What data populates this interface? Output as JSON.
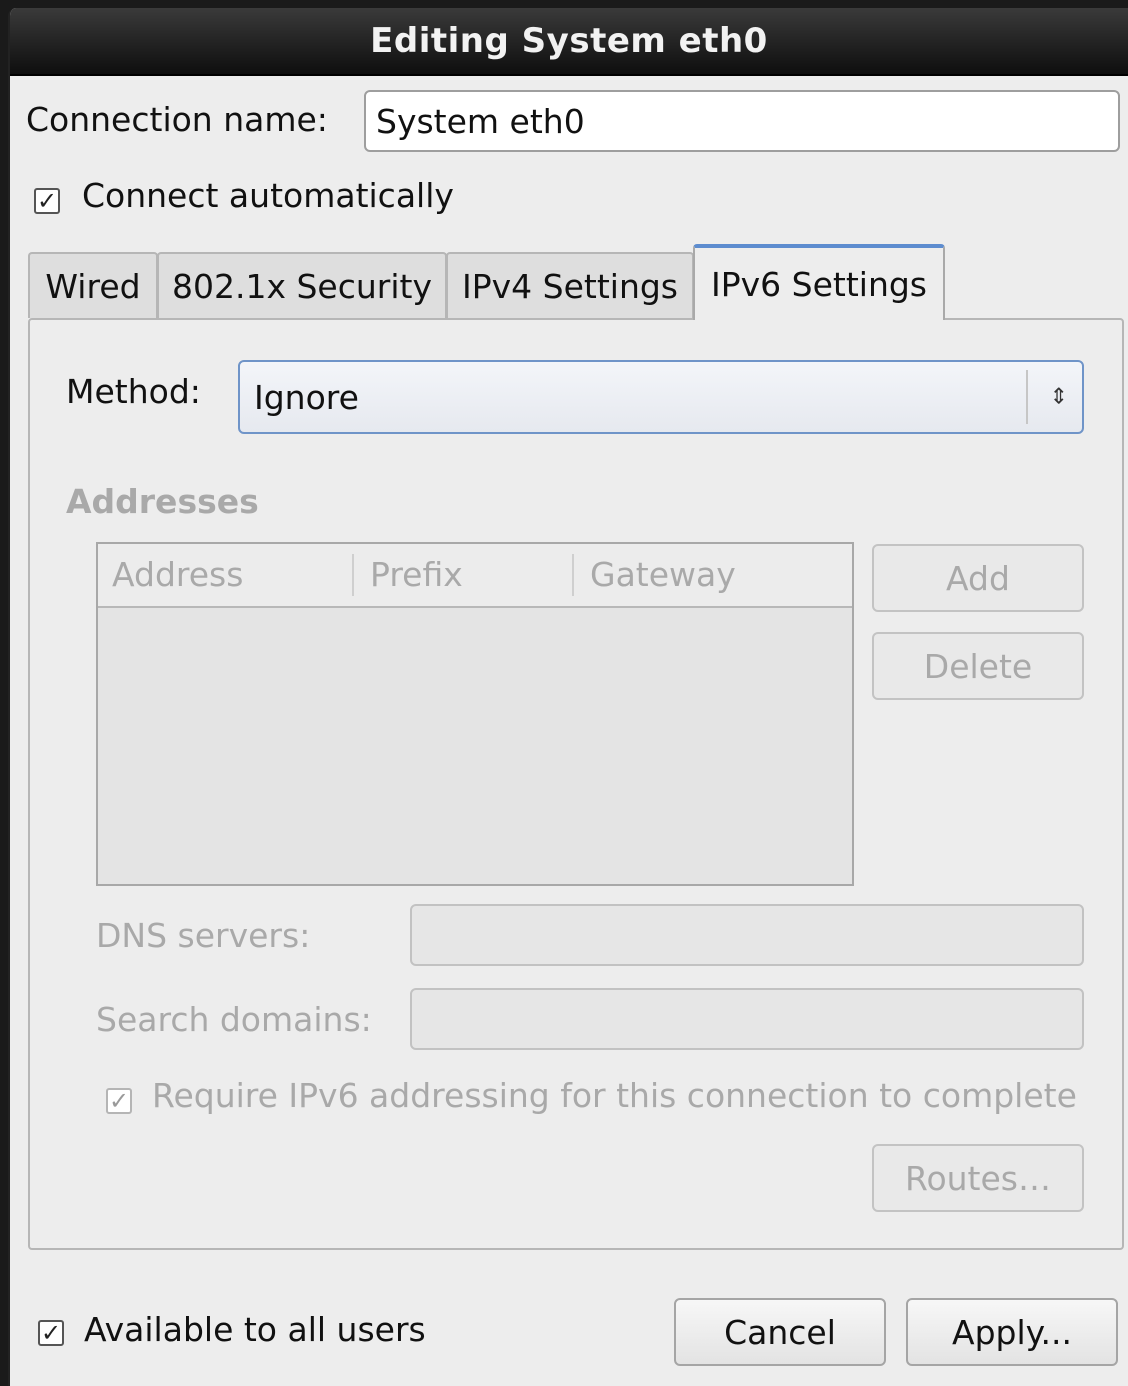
{
  "window": {
    "title": "Editing System eth0"
  },
  "connection": {
    "name_label": "Connection name:",
    "name_value": "System eth0"
  },
  "auto_connect": {
    "label": "Connect automatically",
    "checked": true,
    "mark": "✓"
  },
  "tabs": [
    {
      "label": "Wired",
      "active": false
    },
    {
      "label": "802.1x Security",
      "active": false
    },
    {
      "label": "IPv4 Settings",
      "active": false
    },
    {
      "label": "IPv6 Settings",
      "active": true
    }
  ],
  "ipv6": {
    "method_label": "Method:",
    "method_value": "Ignore",
    "combo_arrow": "⇕",
    "addresses_heading": "Addresses",
    "columns": [
      "Address",
      "Prefix",
      "Gateway"
    ],
    "rows": [],
    "add_label": "Add",
    "delete_label": "Delete",
    "dns_label": "DNS servers:",
    "dns_value": "",
    "search_label": "Search domains:",
    "search_value": "",
    "require_label": "Require IPv6 addressing for this connection to complete",
    "require_checked": true,
    "routes_label": "Routes…"
  },
  "footer": {
    "available_label": "Available to all users",
    "available_checked": true,
    "cancel_label": "Cancel",
    "apply_label": "Apply..."
  },
  "colors": {
    "accent": "#5d8ccf",
    "titlebar": "#1a1a1a",
    "disabled_text": "#a9a9a9"
  }
}
